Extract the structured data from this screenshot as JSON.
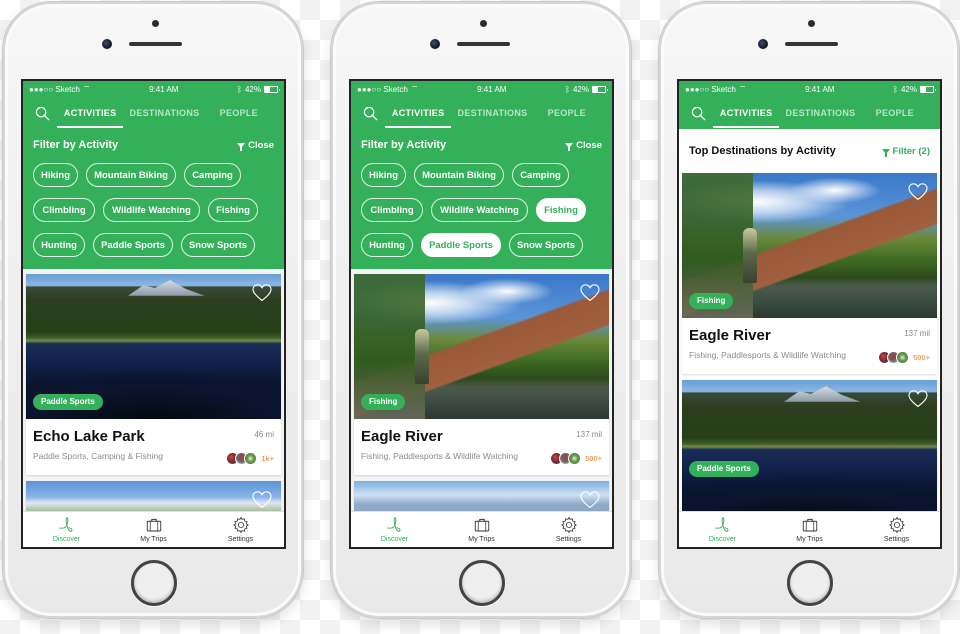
{
  "status_bar": {
    "carrier": "●●●○○ Sketch",
    "time": "9:41 AM",
    "battery": "42%"
  },
  "nav_tabs": [
    "ACTIVITIES",
    "DESTINATIONS",
    "PEOPLE"
  ],
  "filter": {
    "title": "Filter by Activity",
    "close_label": "Close",
    "activities": [
      "Hiking",
      "Mountain Biking",
      "Camping",
      "Climbling",
      "Wildlife Watching",
      "Fishing",
      "Hunting",
      "Paddle Sports",
      "Snow Sports"
    ]
  },
  "screens": [
    {
      "selected_activities": [],
      "cards": [
        {
          "title": "Echo Lake Park",
          "distance": "46 mi",
          "activities": "Paddle Sports, Camping & Fishing",
          "tag": "Paddle Sports",
          "people_count": "1k+"
        }
      ]
    },
    {
      "selected_activities": [
        "Fishing",
        "Paddle Sports"
      ],
      "cards": [
        {
          "title": "Eagle River",
          "distance": "137 mil",
          "activities": "Fishing, Paddlesports & Wildlife Watching",
          "tag": "Fishing",
          "people_count": "500+"
        }
      ]
    },
    {
      "header_title": "Top Destinations by Activity",
      "filter_label": "Filter (2)",
      "cards": [
        {
          "title": "Eagle River",
          "distance": "137 mil",
          "activities": "Fishing, Paddlesports & Wildlife Watching",
          "tag": "Fishing",
          "people_count": "500+"
        },
        {
          "tag": "Paddle Sports"
        }
      ]
    }
  ],
  "tab_bar": [
    {
      "label": "Discover",
      "icon": "discover-icon",
      "active": true
    },
    {
      "label": "My Trips",
      "icon": "briefcase-icon",
      "active": false
    },
    {
      "label": "Settings",
      "icon": "gear-icon",
      "active": false
    }
  ],
  "colors": {
    "brand_green": "#34b05a",
    "count_orange": "#f0a060"
  }
}
